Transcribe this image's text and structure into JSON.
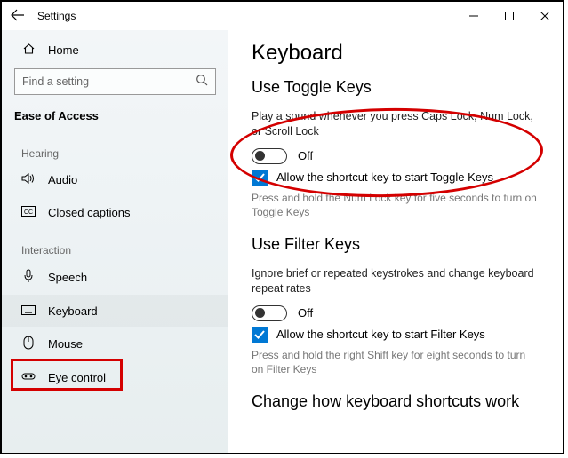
{
  "window": {
    "title": "Settings"
  },
  "sidebar": {
    "home": "Home",
    "search_placeholder": "Find a setting",
    "section": "Ease of Access",
    "categories": {
      "hearing": "Hearing",
      "interaction": "Interaction"
    },
    "items": {
      "audio": "Audio",
      "closed_captions": "Closed captions",
      "speech": "Speech",
      "keyboard": "Keyboard",
      "mouse": "Mouse",
      "eye_control": "Eye control"
    }
  },
  "page": {
    "title": "Keyboard",
    "toggle_keys": {
      "heading": "Use Toggle Keys",
      "desc": "Play a sound whenever you press Caps Lock, Num Lock, or Scroll Lock",
      "state": "Off",
      "shortcut_label": "Allow the shortcut key to start Toggle Keys",
      "shortcut_hint": "Press and hold the Num Lock key for five seconds to turn on Toggle Keys"
    },
    "filter_keys": {
      "heading": "Use Filter Keys",
      "desc": "Ignore brief or repeated keystrokes and change keyboard repeat rates",
      "state": "Off",
      "shortcut_label": "Allow the shortcut key to start Filter Keys",
      "shortcut_hint": "Press and hold the right Shift key for eight seconds to turn on Filter Keys"
    },
    "shortcuts_heading": "Change how keyboard shortcuts work"
  }
}
